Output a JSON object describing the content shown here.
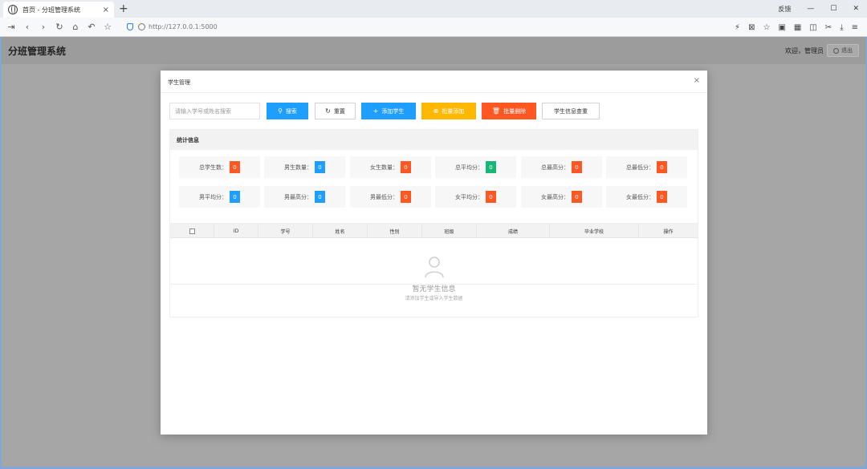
{
  "browser": {
    "tab_title": "首页 - 分班管理系统",
    "tab_close": "×",
    "new_tab": "+",
    "feedback": "反馈",
    "url": "http://127.0.0.1:5000",
    "win_min": "—",
    "win_max": "☐",
    "win_close": "✕",
    "nav": {
      "sidebar": "⇥",
      "back": "‹",
      "forward": "›",
      "reload": "↻",
      "home": "⌂",
      "undo": "↶",
      "favorites": "☆"
    },
    "tools": [
      "⚡",
      "⊠",
      "☆",
      "▣",
      "▦",
      "◫",
      "✂",
      "⤓",
      "≡"
    ]
  },
  "app": {
    "title": "分班管理系统",
    "welcome": "欢迎，管理员",
    "logout_label": "退出"
  },
  "modal": {
    "title": "学生管理",
    "close": "×",
    "search_placeholder": "请输入学号或姓名搜索",
    "buttons": {
      "search": "搜索",
      "reset": "重置",
      "add_student": "添加学生",
      "batch_add": "批量添加",
      "batch_delete": "批量删除",
      "dedupe": "学生信息查重"
    },
    "icons": {
      "search": "⚲",
      "reset": "↻",
      "add": "+",
      "batch_add": "⊕",
      "batch_delete": "🗑"
    }
  },
  "stats": {
    "title": "统计信息",
    "items": [
      {
        "label": "总学生数：",
        "value": "0",
        "color": "#ff5722"
      },
      {
        "label": "男生数量：",
        "value": "0",
        "color": "#1e9fff"
      },
      {
        "label": "女生数量：",
        "value": "0",
        "color": "#ff5722"
      },
      {
        "label": "总平均分：",
        "value": "0",
        "color": "#16b777"
      },
      {
        "label": "总最高分：",
        "value": "0",
        "color": "#ff5722"
      },
      {
        "label": "总最低分：",
        "value": "0",
        "color": "#ff5722"
      },
      {
        "label": "男平均分：",
        "value": "0",
        "color": "#1e9fff"
      },
      {
        "label": "男最高分：",
        "value": "0",
        "color": "#1e9fff"
      },
      {
        "label": "男最低分：",
        "value": "0",
        "color": "#ff5722"
      },
      {
        "label": "女平均分：",
        "value": "0",
        "color": "#ff5722"
      },
      {
        "label": "女最高分：",
        "value": "0",
        "color": "#ff5722"
      },
      {
        "label": "女最低分：",
        "value": "0",
        "color": "#ff5722"
      }
    ]
  },
  "table": {
    "columns": [
      "ID",
      "学号",
      "姓名",
      "性别",
      "班级",
      "成绩",
      "毕业学校",
      "操作"
    ],
    "empty_title": "暂无学生信息",
    "empty_sub": "请添加学生或导入学生数据"
  }
}
